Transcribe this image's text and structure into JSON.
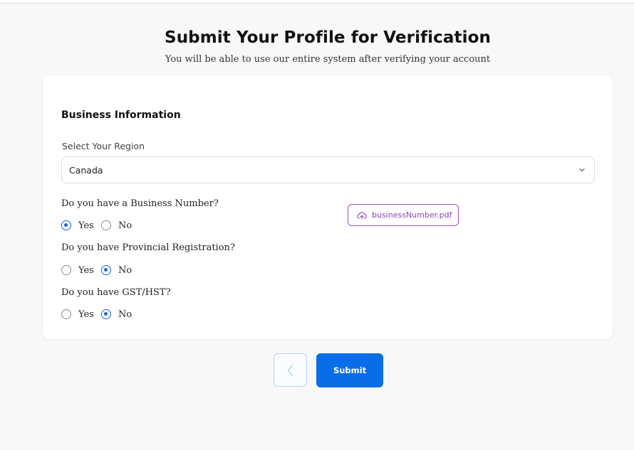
{
  "header": {
    "title": "Submit Your Profile for Verification",
    "subtitle": "You will be able to use our entire system after verifying your account"
  },
  "form": {
    "section_title": "Business Information",
    "region": {
      "label": "Select Your Region",
      "value": "Canada",
      "icon": "chevron-down-icon"
    },
    "questions": [
      {
        "question": "Do you have a Business Number?",
        "options": [
          "Yes",
          "No"
        ],
        "selected": "Yes",
        "uploaded_file": "businessNumber.pdf"
      },
      {
        "question": "Do you have Provincial Registration?",
        "options": [
          "Yes",
          "No"
        ],
        "selected": "No"
      },
      {
        "question": "Do you have GST/HST?",
        "options": [
          "Yes",
          "No"
        ],
        "selected": "No"
      }
    ],
    "file_icon": "cloud-upload-icon"
  },
  "actions": {
    "back_icon": "chevron-left-icon",
    "submit_label": "Submit"
  },
  "colors": {
    "accent": "#0a6de8",
    "radio_selected": "#1a66e0",
    "file_chip": "#8e3fb8"
  }
}
